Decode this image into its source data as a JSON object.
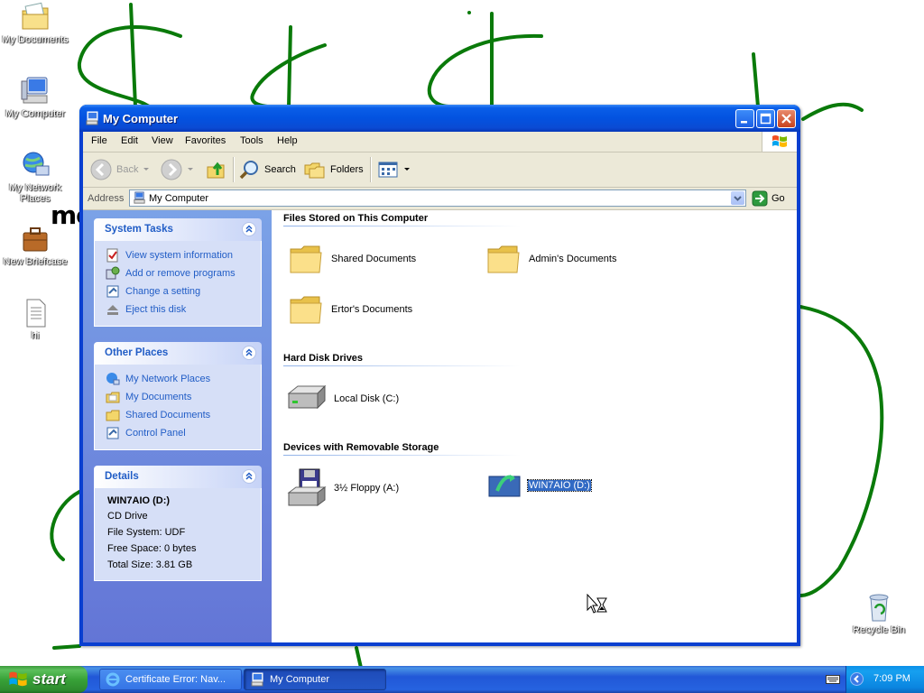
{
  "desktop": {
    "icons": [
      {
        "label": "My Documents",
        "icon": "my-documents-icon"
      },
      {
        "label": "My Computer",
        "icon": "my-computer-icon"
      },
      {
        "label": "My Network Places",
        "icon": "network-places-icon"
      },
      {
        "label": "New Briefcase",
        "icon": "briefcase-icon"
      },
      {
        "label": "hi",
        "icon": "text-file-icon"
      },
      {
        "label": "Recycle Bin",
        "icon": "recycle-bin-icon"
      }
    ],
    "stray_text": "mo",
    "scribble_color": "#0a7a0a"
  },
  "window": {
    "title": "My Computer",
    "menu": [
      "File",
      "Edit",
      "View",
      "Favorites",
      "Tools",
      "Help"
    ],
    "toolbar": {
      "back": "Back",
      "search": "Search",
      "folders": "Folders"
    },
    "address": {
      "label": "Address",
      "value": "My Computer",
      "go": "Go"
    }
  },
  "taskpane": {
    "system_tasks": {
      "title": "System Tasks",
      "items": [
        "View system information",
        "Add or remove programs",
        "Change a setting",
        "Eject this disk"
      ]
    },
    "other_places": {
      "title": "Other Places",
      "items": [
        "My Network Places",
        "My Documents",
        "Shared Documents",
        "Control Panel"
      ]
    },
    "details": {
      "title": "Details",
      "name": "WIN7AIO (D:)",
      "type": "CD Drive",
      "file_system": "File System: UDF",
      "free_space": "Free Space: 0 bytes",
      "total_size": "Total Size: 3.81 GB"
    }
  },
  "content": {
    "groups": [
      {
        "title": "Files Stored on This Computer",
        "items": [
          "Shared Documents",
          "Admin's Documents",
          "Ertor's Documents"
        ]
      },
      {
        "title": "Hard Disk Drives",
        "items": [
          "Local Disk (C:)"
        ]
      },
      {
        "title": "Devices with Removable Storage",
        "items": [
          "3½ Floppy (A:)",
          "WIN7AIO (D:)"
        ]
      }
    ],
    "selected_item": "WIN7AIO (D:)"
  },
  "taskbar": {
    "start": "start",
    "buttons": [
      {
        "label": "Certificate Error: Nav...",
        "active": false
      },
      {
        "label": "My Computer",
        "active": true
      }
    ],
    "clock": "7:09 PM"
  },
  "colors": {
    "xp_blue": "#0a3fd0",
    "link_blue": "#215dc6",
    "selection": "#316ac5",
    "start_green": "#38a238"
  }
}
